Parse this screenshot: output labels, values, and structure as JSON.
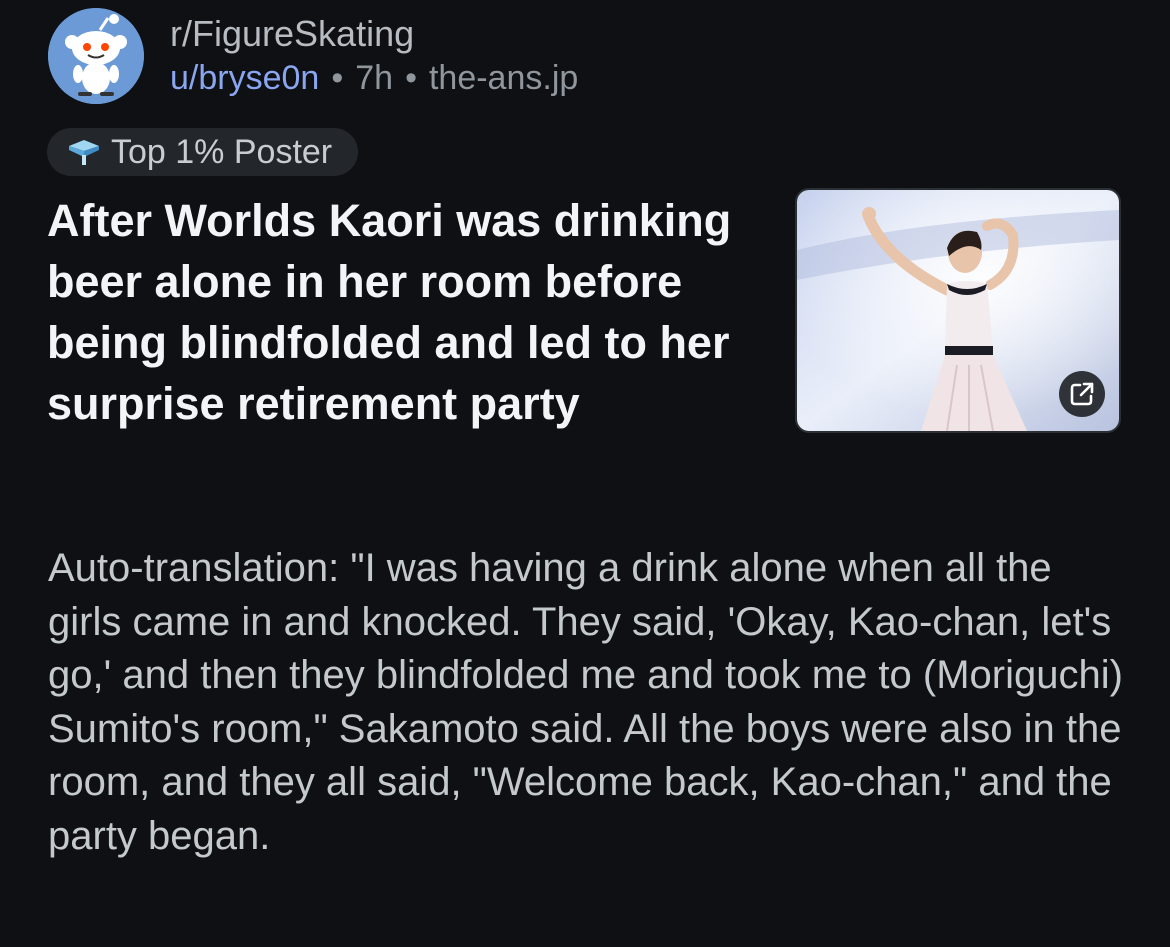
{
  "post": {
    "subreddit": "r/FigureSkating",
    "username": "u/bryse0n",
    "time": "7h",
    "domain": "the-ans.jp",
    "separator": "•",
    "badge": {
      "icon": "diamond-badge-icon",
      "label": "Top 1% Poster"
    },
    "title": "After Worlds Kaori was drinking beer alone in her room before being blindfolded and led to her surprise retirement party",
    "thumbnail": {
      "icon": "external-link-icon"
    },
    "body": "Auto-translation: \"I was having a drink alone when all the girls came in and knocked. They said, 'Okay, Kao-chan, let's go,' and then they blindfolded me and took me to (Moriguchi) Sumito's room,\" Sakamoto said. All the boys were also in the room, and they all said, \"Welcome back, Kao-chan,\" and the party began."
  },
  "colors": {
    "background": "#0e1013",
    "username": "#8aa6f0",
    "badge_bg": "#23272b",
    "title": "#f2f4f5",
    "body": "#c4c9ce",
    "avatar_bg": "#6b9ad6"
  }
}
